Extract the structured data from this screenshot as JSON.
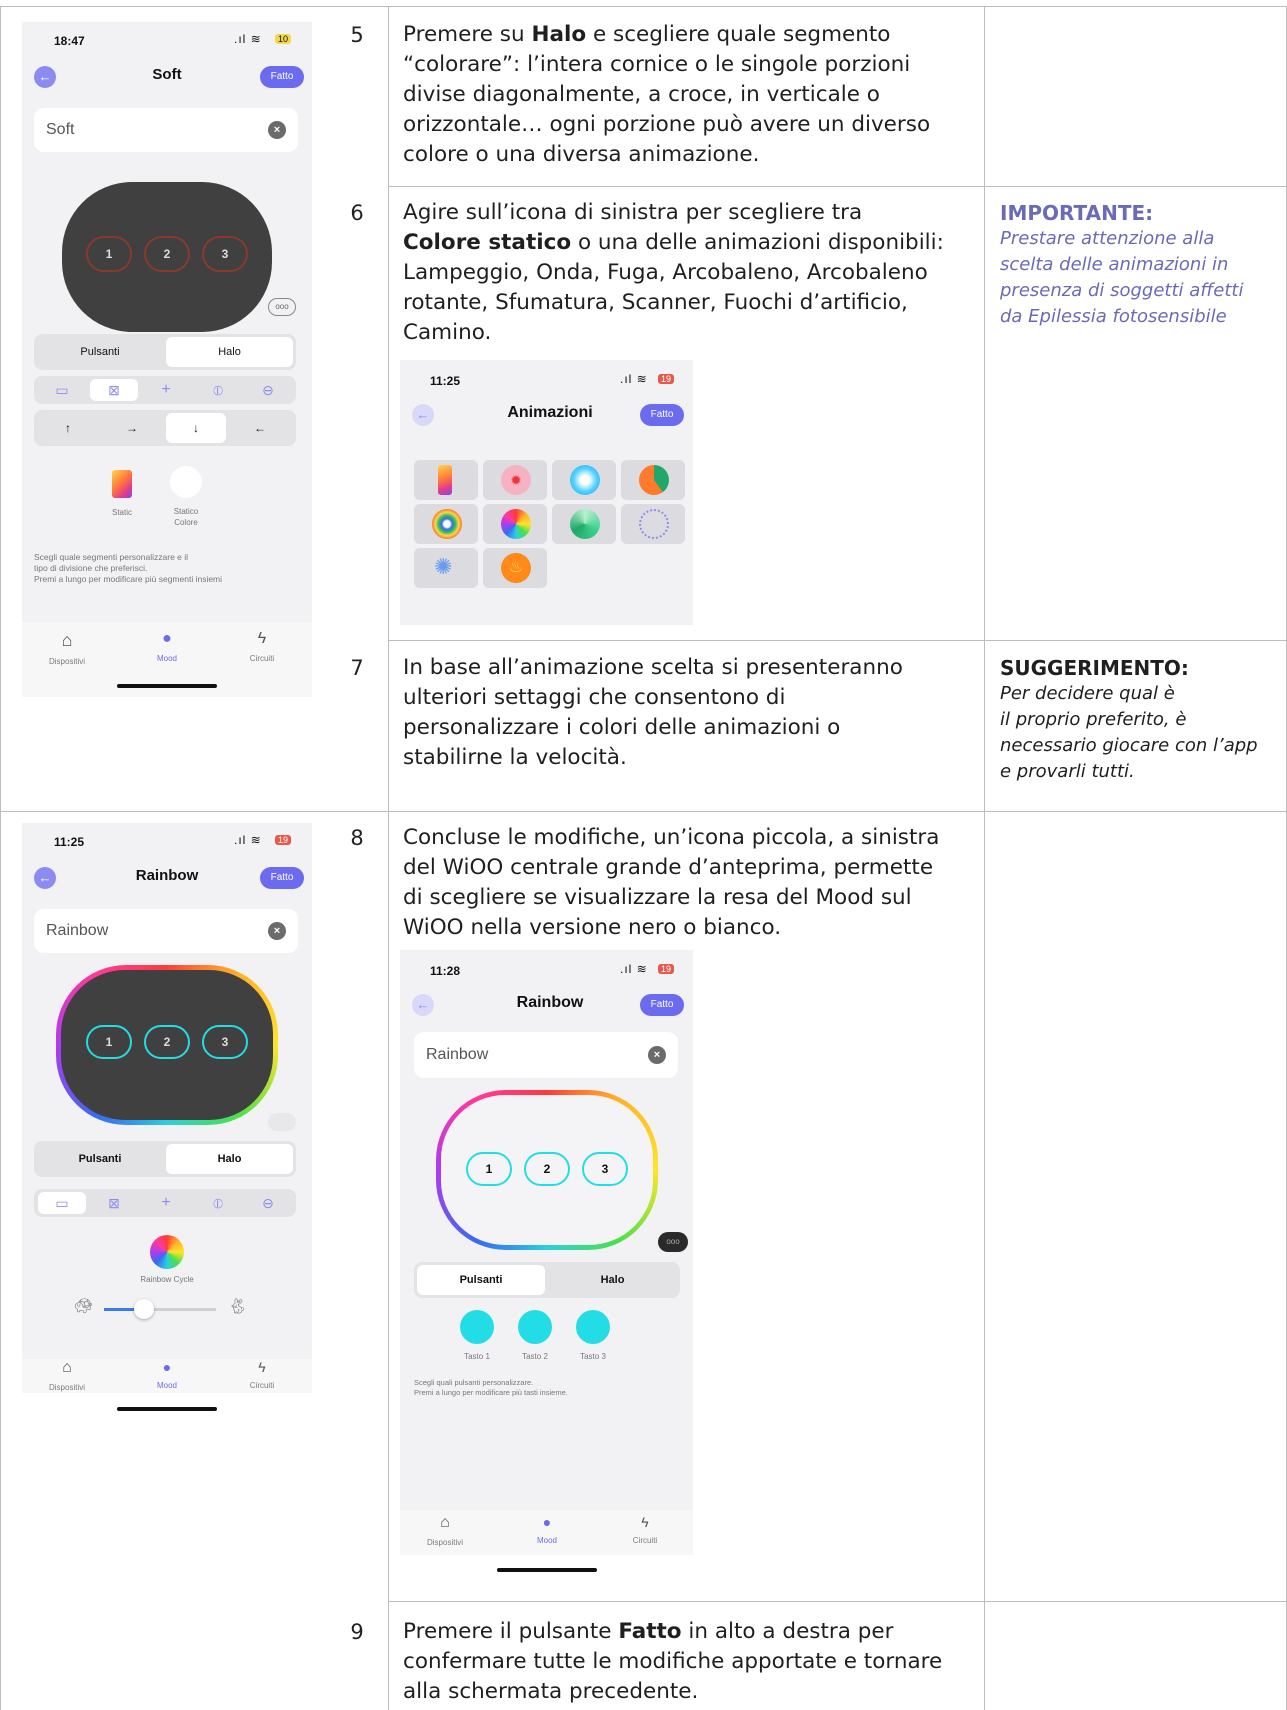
{
  "steps": [
    {
      "number": "5",
      "lines": [
        [
          {
            "t": "Premere su "
          },
          {
            "t": "Halo",
            "b": true
          },
          {
            "t": " e scegliere quale segmento"
          }
        ],
        [
          {
            "t": "“colorare”: l’intera cornice o le singole porzioni"
          }
        ],
        [
          {
            "t": "divise diagonalmente, a croce, in verticale o"
          }
        ],
        [
          {
            "t": "orizzontale… ogni porzione può avere un diverso"
          }
        ],
        [
          {
            "t": "colore o una diversa animazione."
          }
        ]
      ]
    },
    {
      "number": "6",
      "lines": [
        [
          {
            "t": "Agire sull’icona di sinistra per scegliere tra"
          }
        ],
        [
          {
            "t": "Colore statico",
            "b": true
          },
          {
            "t": " o una delle animazioni disponibili:"
          }
        ],
        [
          {
            "t": "Lampeggio, Onda, Fuga, Arcobaleno, Arcobaleno"
          }
        ],
        [
          {
            "t": "rotante, Sfumatura, Scanner, Fuochi d’artificio,"
          }
        ],
        [
          {
            "t": "Camino."
          }
        ]
      ],
      "note": {
        "title": "IMPORTANTE:",
        "lines": [
          "Prestare attenzione alla",
          "scelta delle animazioni in",
          "presenza di soggetti affetti",
          "da Epilessia fotosensibile"
        ]
      }
    },
    {
      "number": "7",
      "lines": [
        [
          {
            "t": "In base all’animazione scelta si presenteranno"
          }
        ],
        [
          {
            "t": "ulteriori settaggi che consentono di"
          }
        ],
        [
          {
            "t": "personalizzare i colori delle animazioni o"
          }
        ],
        [
          {
            "t": "stabilirne la velocità."
          }
        ]
      ],
      "note": {
        "title": "SUGGERIMENTO:",
        "lines": [
          "Per decidere qual è",
          "il proprio preferito, è",
          "necessario giocare con l’app",
          "e provarli tutti."
        ]
      }
    },
    {
      "number": "8",
      "lines": [
        [
          {
            "t": "Concluse le modifiche, un’icona piccola, a sinistra"
          }
        ],
        [
          {
            "t": "del WiOO centrale grande d’anteprima, permette"
          }
        ],
        [
          {
            "t": "di scegliere se visualizzare la resa del Mood sul"
          }
        ],
        [
          {
            "t": "WiOO nella versione nero o bianco."
          }
        ]
      ]
    },
    {
      "number": "9",
      "lines": [
        [
          {
            "t": "Premere il pulsante "
          },
          {
            "t": "Fatto",
            "b": true
          },
          {
            "t": " in alto a destra per"
          }
        ],
        [
          {
            "t": "confermare tutte le modifiche apportate e tornare"
          }
        ],
        [
          {
            "t": "alla schermata precedente."
          }
        ]
      ]
    }
  ],
  "phone_soft": {
    "time": "18:47",
    "battery": "10",
    "title": "Soft",
    "done": "Fatto",
    "field_value": "Soft",
    "buttons": [
      "1",
      "2",
      "3"
    ],
    "seg_left": "Pulsanti",
    "seg_right": "Halo",
    "arrows": [
      "↑",
      "→",
      "↓",
      "←"
    ],
    "opt1": "Static",
    "opt2": "Statico\nColore",
    "hint": "Scegli quale segmenti personalizzare e il\ntipo di divisione che preferisci.\nPremi a lungo per modificare più segmenti insiemi",
    "tabs": [
      "Dispositivi",
      "Mood",
      "Circuiti"
    ]
  },
  "phone_anim": {
    "time": "11:25",
    "battery": "19",
    "title": "Animazioni",
    "done": "Fatto"
  },
  "phone_rainbow_dark": {
    "time": "11:25",
    "battery": "19",
    "title": "Rainbow",
    "done": "Fatto",
    "field_value": "Rainbow",
    "buttons": [
      "1",
      "2",
      "3"
    ],
    "seg_left": "Pulsanti",
    "seg_right": "Halo",
    "effect_label": "Rainbow Cycle",
    "tabs": [
      "Dispositivi",
      "Mood",
      "Circuiti"
    ]
  },
  "phone_rainbow_light": {
    "time": "11:28",
    "battery": "19",
    "title": "Rainbow",
    "done": "Fatto",
    "field_value": "Rainbow",
    "buttons": [
      "1",
      "2",
      "3"
    ],
    "seg_left": "Pulsanti",
    "seg_right": "Halo",
    "keys": [
      "Tasto 1",
      "Tasto 2",
      "Tasto 3"
    ],
    "hint": "Scegli quali pulsanti personalizzare.\nPremi a lungo per modificare più tasti insieme.",
    "tabs": [
      "Dispositivi",
      "Mood",
      "Circuiti"
    ]
  },
  "colors": {
    "accent": "#6b6bf0",
    "note_purple": "#6a6ab8",
    "cyan": "#22dde6",
    "button_brown": "#8a3a2a"
  }
}
